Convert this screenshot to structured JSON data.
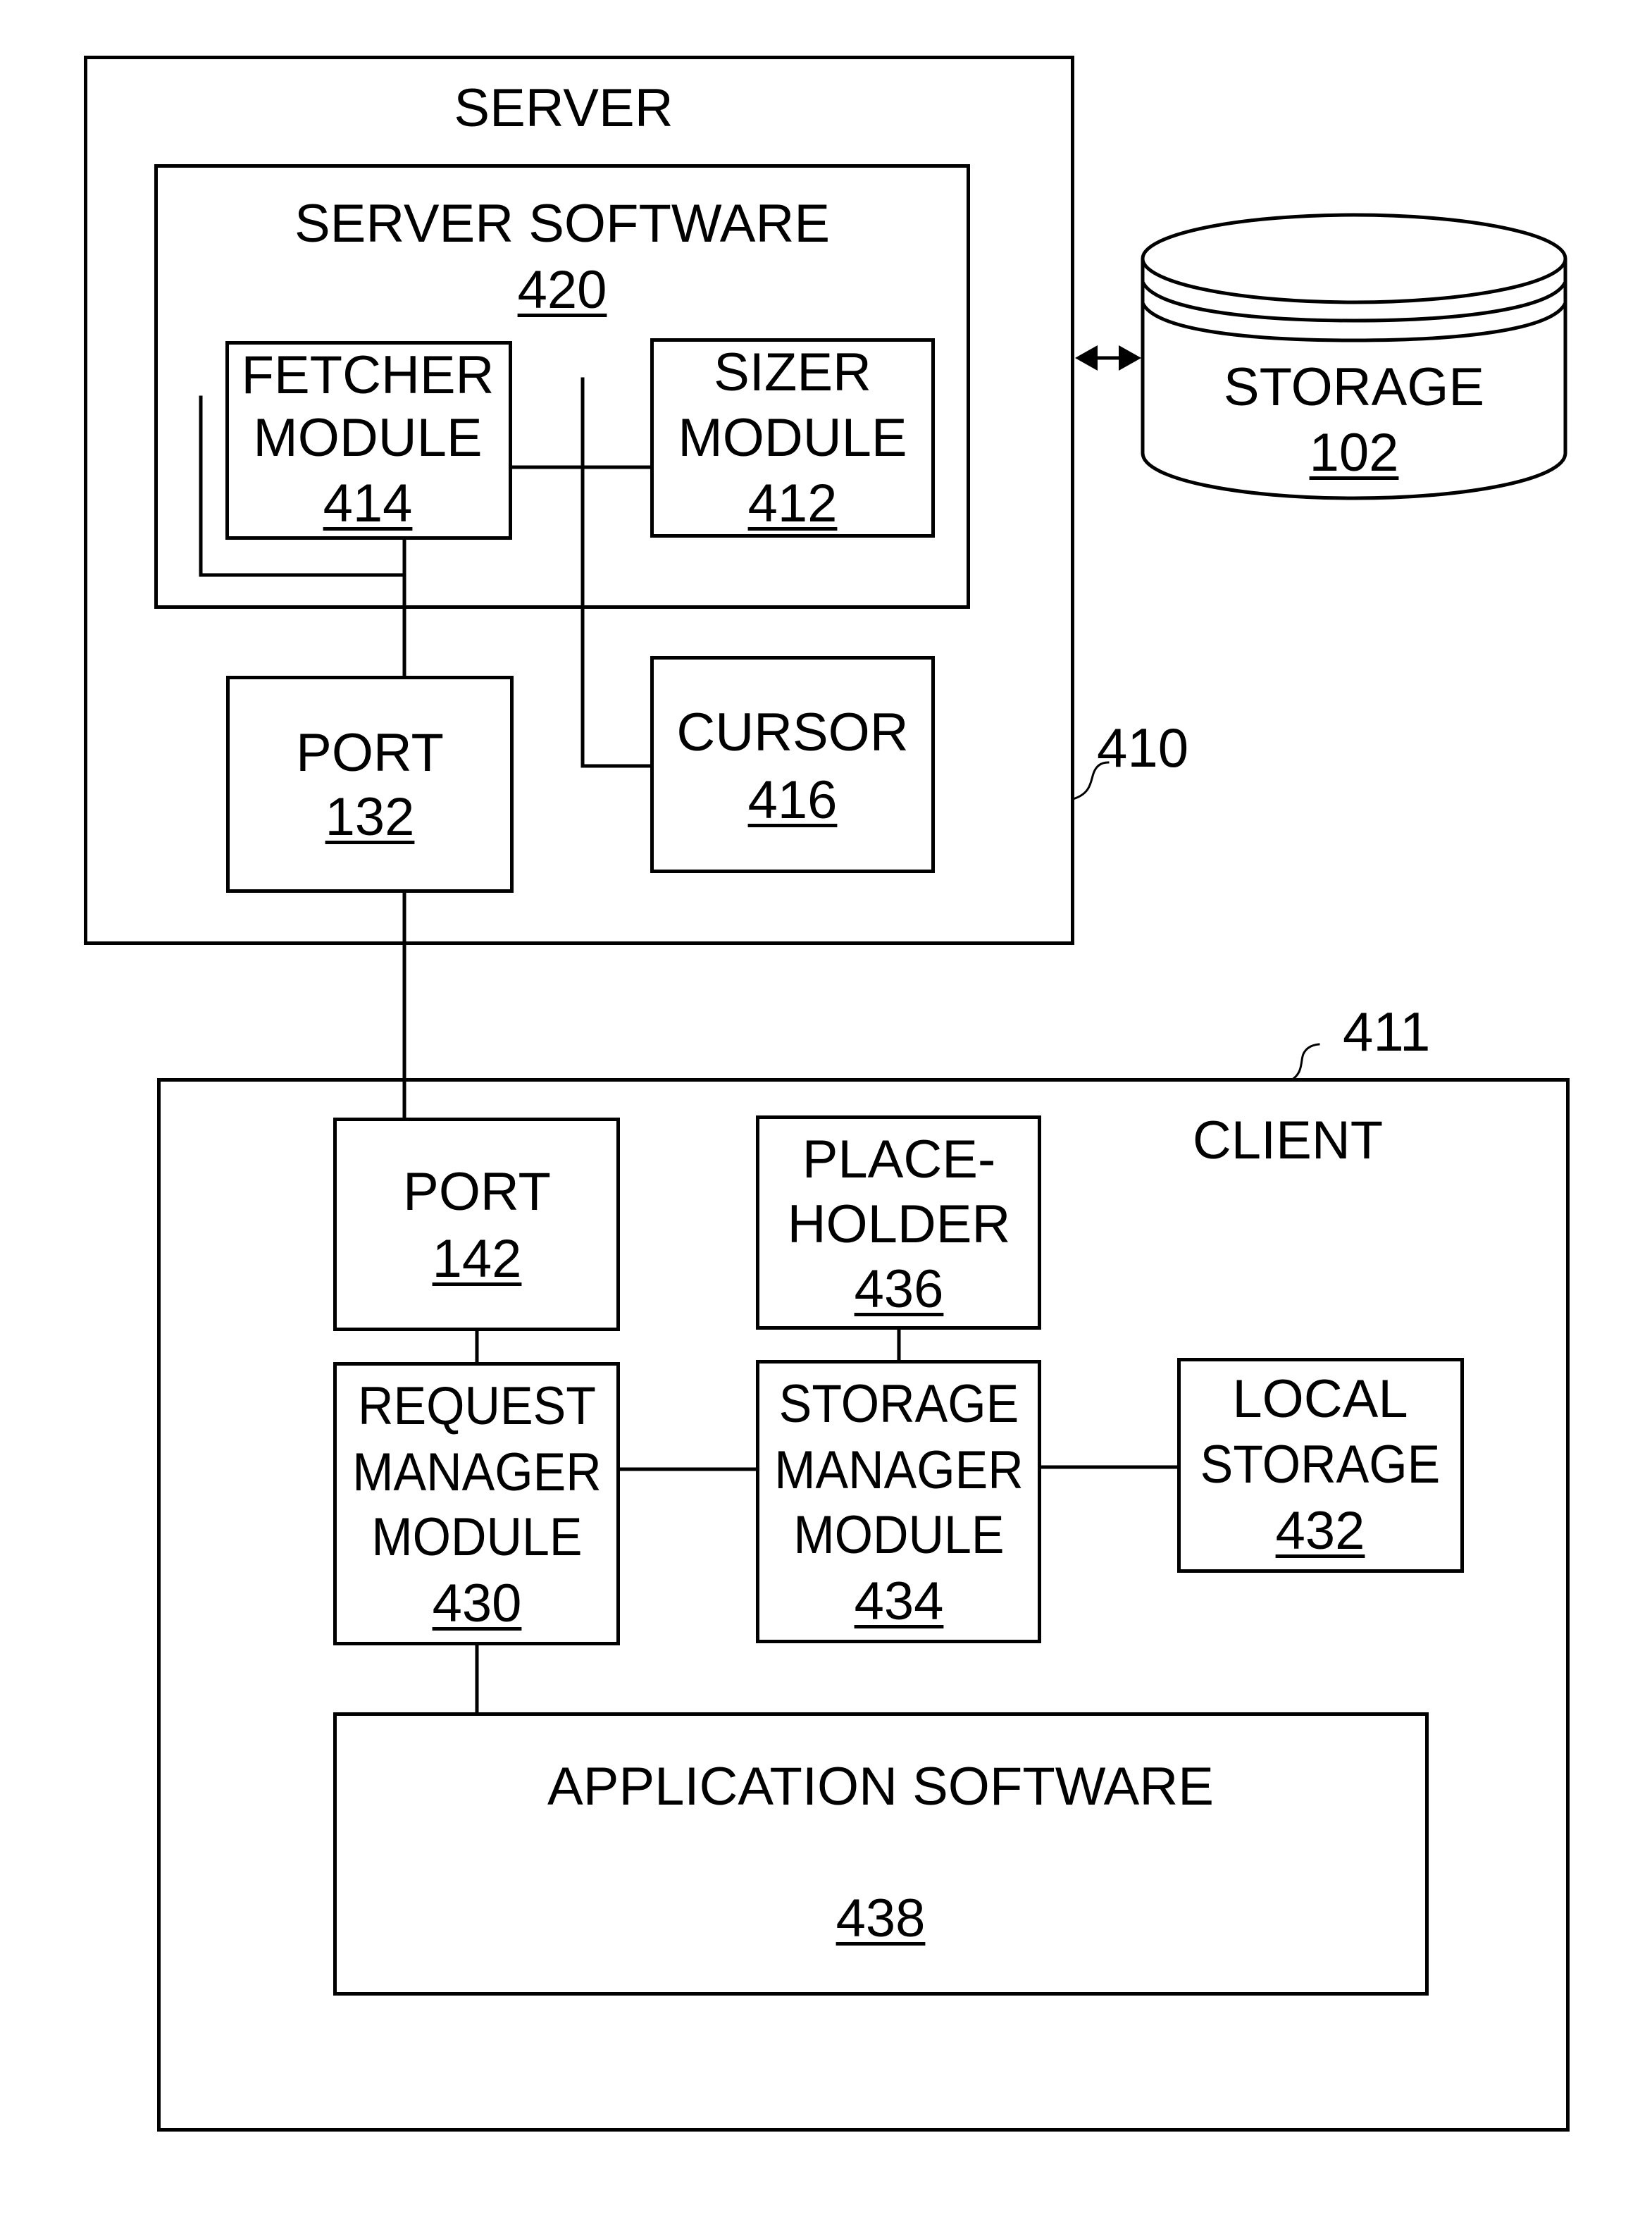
{
  "figure": {
    "server": {
      "title": "SERVER",
      "ref": "410",
      "software": {
        "title": "SERVER SOFTWARE",
        "ref": "420"
      },
      "fetcher": {
        "line1": "FETCHER",
        "line2": "MODULE",
        "ref": "414"
      },
      "sizer": {
        "line1": "SIZER",
        "line2": "MODULE",
        "ref": "412"
      },
      "port": {
        "line1": "PORT",
        "ref": "132"
      },
      "cursor": {
        "line1": "CURSOR",
        "ref": "416"
      }
    },
    "storage": {
      "line1": "STORAGE",
      "ref": "102"
    },
    "client": {
      "title": "CLIENT",
      "ref": "411",
      "port": {
        "line1": "PORT",
        "ref": "142"
      },
      "placeholder": {
        "line1": "PLACE-",
        "line2": "HOLDER",
        "ref": "436"
      },
      "request_manager": {
        "line1": "REQUEST",
        "line2": "MANAGER",
        "line3": "MODULE",
        "ref": "430"
      },
      "storage_manager": {
        "line1": "STORAGE",
        "line2": "MANAGER",
        "line3": "MODULE",
        "ref": "434"
      },
      "local_storage": {
        "line1": "LOCAL",
        "line2": "STORAGE",
        "ref": "432"
      },
      "application_software": {
        "line1": "APPLICATION SOFTWARE",
        "ref": "438"
      }
    }
  }
}
